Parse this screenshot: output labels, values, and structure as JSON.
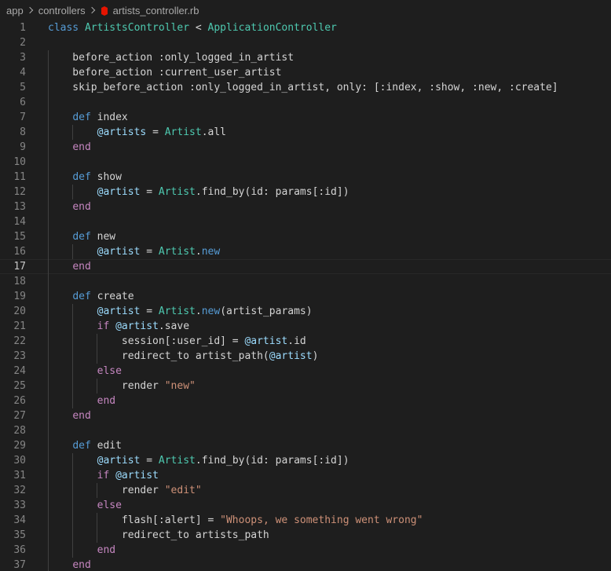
{
  "breadcrumb": {
    "items": [
      "app",
      "controllers"
    ],
    "file": "artists_controller.rb",
    "file_icon": "ruby-icon"
  },
  "editor": {
    "current_line": 17,
    "lines": [
      {
        "n": "1",
        "text": "class ArtistsController < ApplicationController"
      },
      {
        "n": "2",
        "text": ""
      },
      {
        "n": "3",
        "text": "    before_action :only_logged_in_artist"
      },
      {
        "n": "4",
        "text": "    before_action :current_user_artist"
      },
      {
        "n": "5",
        "text": "    skip_before_action :only_logged_in_artist, only: [:index, :show, :new, :create]"
      },
      {
        "n": "6",
        "text": ""
      },
      {
        "n": "7",
        "text": "    def index"
      },
      {
        "n": "8",
        "text": "        @artists = Artist.all"
      },
      {
        "n": "9",
        "text": "    end"
      },
      {
        "n": "10",
        "text": ""
      },
      {
        "n": "11",
        "text": "    def show"
      },
      {
        "n": "12",
        "text": "        @artist = Artist.find_by(id: params[:id])"
      },
      {
        "n": "13",
        "text": "    end"
      },
      {
        "n": "14",
        "text": ""
      },
      {
        "n": "15",
        "text": "    def new"
      },
      {
        "n": "16",
        "text": "        @artist = Artist.new"
      },
      {
        "n": "17",
        "text": "    end"
      },
      {
        "n": "18",
        "text": ""
      },
      {
        "n": "19",
        "text": "    def create"
      },
      {
        "n": "20",
        "text": "        @artist = Artist.new(artist_params)"
      },
      {
        "n": "21",
        "text": "        if @artist.save"
      },
      {
        "n": "22",
        "text": "            session[:user_id] = @artist.id"
      },
      {
        "n": "23",
        "text": "            redirect_to artist_path(@artist)"
      },
      {
        "n": "24",
        "text": "        else"
      },
      {
        "n": "25",
        "text": "            render \"new\""
      },
      {
        "n": "26",
        "text": "        end"
      },
      {
        "n": "27",
        "text": "    end"
      },
      {
        "n": "28",
        "text": ""
      },
      {
        "n": "29",
        "text": "    def edit"
      },
      {
        "n": "30",
        "text": "        @artist = Artist.find_by(id: params[:id])"
      },
      {
        "n": "31",
        "text": "        if @artist"
      },
      {
        "n": "32",
        "text": "            render \"edit\""
      },
      {
        "n": "33",
        "text": "        else"
      },
      {
        "n": "34",
        "text": "            flash[:alert] = \"Whoops, we something went wrong\""
      },
      {
        "n": "35",
        "text": "            redirect_to artists_path"
      },
      {
        "n": "36",
        "text": "        end"
      },
      {
        "n": "37",
        "text": "    end"
      }
    ]
  },
  "colors": {
    "background": "#1e1e1e",
    "keyword": "#569cd6",
    "control": "#c586c0",
    "class": "#4ec9b0",
    "variable": "#9cdcfe",
    "string": "#ce9178",
    "ruby_icon": "#e51400"
  }
}
